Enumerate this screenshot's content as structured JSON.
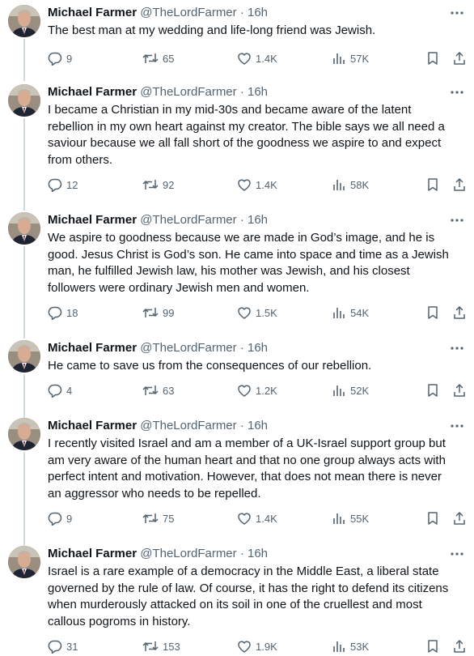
{
  "author": {
    "name": "Michael Farmer",
    "handle": "@TheLordFarmer",
    "separator": "·"
  },
  "icons": {
    "reply": "reply-icon",
    "repost": "repost-icon",
    "like": "heart-icon",
    "views": "views-icon",
    "bookmark": "bookmark-icon",
    "share": "share-icon",
    "more": "more-icon"
  },
  "colors": {
    "text": "#0f1419",
    "secondary": "#536471",
    "thread_line": "#cfd9de"
  },
  "tweets": [
    {
      "time": "16h",
      "text": "The best man at my wedding and life-long friend was Jewish.",
      "replies": "9",
      "reposts": "65",
      "likes": "1.4K",
      "views": "57K"
    },
    {
      "time": "16h",
      "text": "I became a Christian in my mid-30s and became aware of the latent\nrebellion in my own heart against my creator. The bible says we all need a\nsaviour because we all fall short of the goodness we aspire to and expect\nfrom others.",
      "replies": "12",
      "reposts": "92",
      "likes": "1.4K",
      "views": "58K"
    },
    {
      "time": "16h",
      "text": "We aspire to goodness because we are made in God’s image, and he is\ngood. Jesus Christ is God’s son. He came into space and time as a Jewish\nman, he fulfilled Jewish law, his mother was Jewish, and his closest\nfollowers were ordinary Jewish men and women.",
      "replies": "18",
      "reposts": "99",
      "likes": "1.5K",
      "views": "54K"
    },
    {
      "time": "16h",
      "text": "He came to save us from the consequences of our rebellion.",
      "replies": "4",
      "reposts": "63",
      "likes": "1.2K",
      "views": "52K"
    },
    {
      "time": "16h",
      "text": "I recently visited Israel and am a member of a UK-Israel support group but\nam very aware of the human heart and that no one group always acts with\nperfect intent and motivation. However, that does not mean there is never\nan aggressor who needs to be repelled.",
      "replies": "9",
      "reposts": "75",
      "likes": "1.4K",
      "views": "55K"
    },
    {
      "time": "16h",
      "text": "Israel is a rare example of a democracy in the Middle East, a liberal state\ngoverned by the rule of law. Of course, it has the right to defend its citizens\nwhen murderously attacked on its soil in one of the cruellest and most\ncallous pogroms in history.",
      "replies": "31",
      "reposts": "153",
      "likes": "1.9K",
      "views": "53K"
    }
  ]
}
